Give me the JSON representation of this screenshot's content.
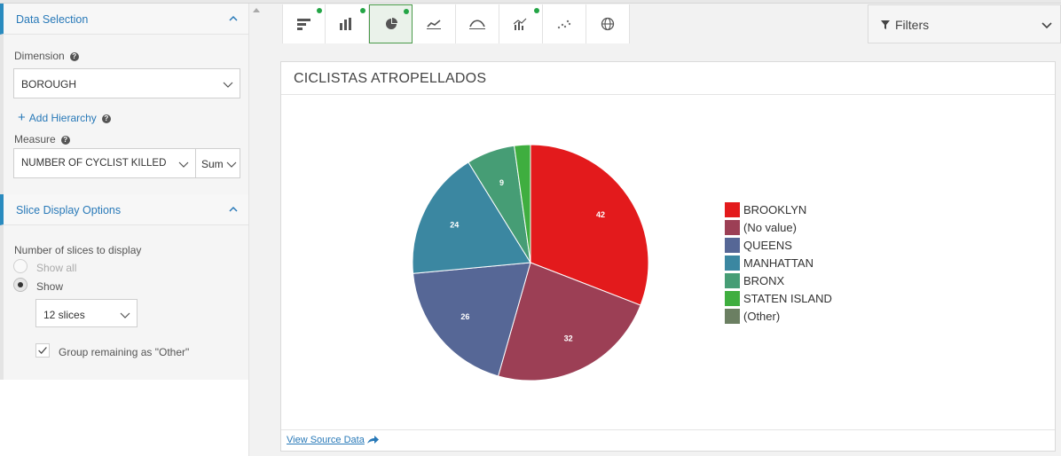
{
  "sidebar": {
    "data_selection": {
      "title": "Data Selection",
      "dimension_label": "Dimension",
      "dimension_value": "BOROUGH",
      "add_hierarchy": "Add Hierarchy",
      "measure_label": "Measure",
      "measure_value": "NUMBER OF CYCLIST KILLED",
      "aggregation": "Sum"
    },
    "slice_options": {
      "title": "Slice Display Options",
      "slices_label": "Number of slices to display",
      "show_all": "Show all",
      "show": "Show",
      "slices_value": "12 slices",
      "group_other": "Group remaining as \"Other\"",
      "group_other_checked": true
    }
  },
  "toolbar": {
    "buttons": [
      {
        "icon": "sorted-bar-icon",
        "dot": true
      },
      {
        "icon": "bar-chart-icon",
        "dot": true
      },
      {
        "icon": "pie-chart-icon",
        "dot": true,
        "active": true
      },
      {
        "icon": "line-chart-icon",
        "dot": false
      },
      {
        "icon": "area-chart-icon",
        "dot": false
      },
      {
        "icon": "combo-chart-icon",
        "dot": true
      },
      {
        "icon": "scatter-icon",
        "dot": false
      },
      {
        "icon": "globe-icon",
        "dot": false
      }
    ],
    "filters_label": "Filters"
  },
  "chart_card": {
    "title": "CICLISTAS ATROPELLADOS",
    "view_source": "View Source Data"
  },
  "chart_data": {
    "type": "pie",
    "title": "CICLISTAS ATROPELLADOS",
    "slices": [
      {
        "label": "BROOKLYN",
        "value": 42,
        "color": "#e31a1c"
      },
      {
        "label": "(No value)",
        "value": 32,
        "color": "#9c3f55"
      },
      {
        "label": "QUEENS",
        "value": 26,
        "color": "#566796"
      },
      {
        "label": "MANHATTAN",
        "value": 24,
        "color": "#3b87a1"
      },
      {
        "label": "BRONX",
        "value": 9,
        "color": "#469d75"
      },
      {
        "label": "STATEN ISLAND",
        "value": 3,
        "color": "#3fae3f"
      },
      {
        "label": "(Other)",
        "value": 0,
        "color": "#6b7f62"
      }
    ],
    "legend": "right"
  }
}
